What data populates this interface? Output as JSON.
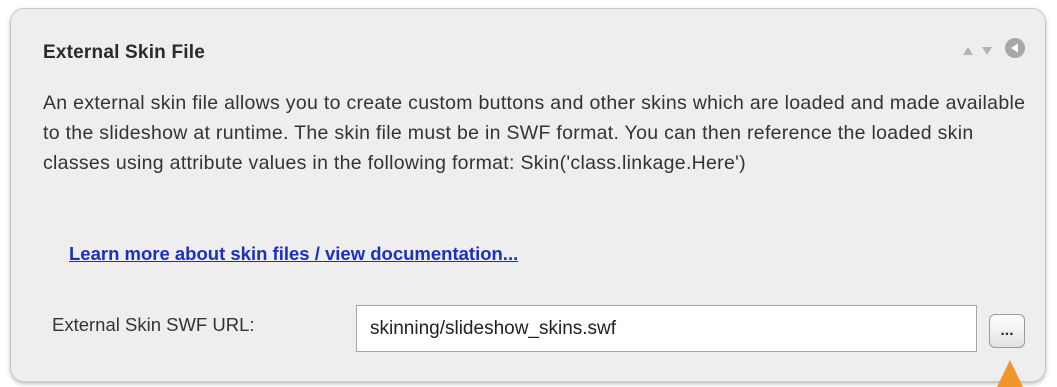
{
  "panel": {
    "title": "External Skin File",
    "description": "An external skin file allows you to create custom buttons and other skins which are loaded and made available to the slideshow at runtime.  The skin file must be in SWF format.  You can then reference the loaded skin classes using attribute values in the following format: Skin('class.linkage.Here')",
    "link_text": "Learn more about skin files / view documentation...",
    "field_label": "External Skin SWF URL:",
    "field_value": "skinning/slideshow_skins.swf",
    "browse_label": "...",
    "icons": {
      "move_up": "triangle-up-icon",
      "move_down": "triangle-down-icon",
      "collapse": "circle-left-arrow-icon",
      "pointer": "orange-arrow-icon"
    },
    "colors": {
      "link": "#1a2fc7",
      "accent_arrow": "#f0962a",
      "panel_bg": "#eeeeee"
    }
  }
}
